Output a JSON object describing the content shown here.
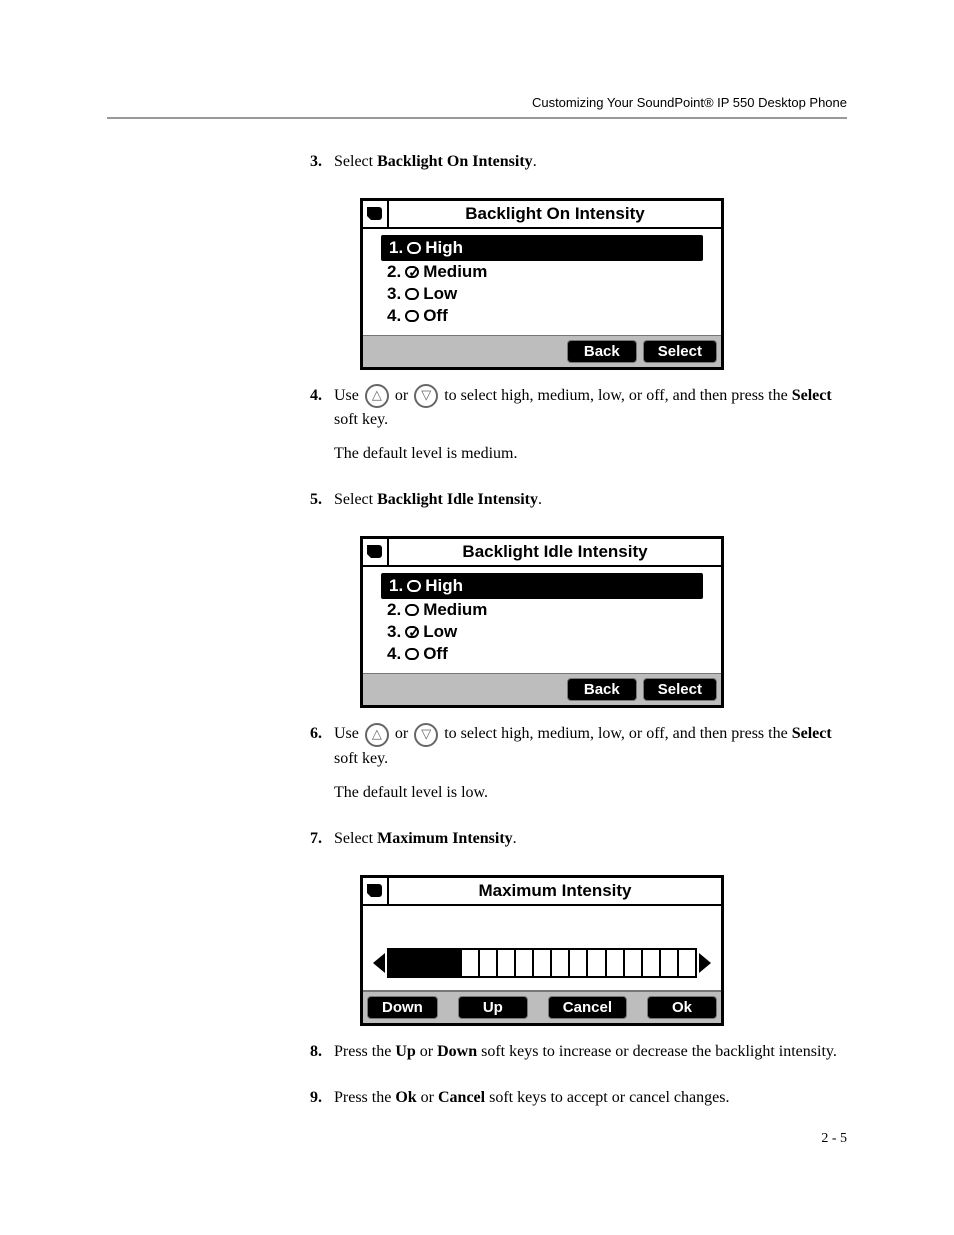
{
  "header": {
    "title": "Customizing Your SoundPoint® IP 550 Desktop Phone"
  },
  "footer": {
    "label": "2 - 5"
  },
  "steps": {
    "s3": {
      "num": "3.",
      "text_a": "Select ",
      "text_b": "Backlight On Intensity",
      "text_c": "."
    },
    "s4": {
      "num": "4.",
      "text_a": "Use ",
      "text_b": " or ",
      "text_c": " to select high, medium, low, or off, and then press the ",
      "text_d": "Select",
      "text_e": " soft key.",
      "default_line": "The default level is medium."
    },
    "s5": {
      "num": "5.",
      "text_a": "Select ",
      "text_b": "Backlight Idle Intensity",
      "text_c": "."
    },
    "s6": {
      "num": "6.",
      "text_a": "Use ",
      "text_b": " or ",
      "text_c": " to select high, medium, low, or off, and then press the ",
      "text_d": "Select",
      "text_e": " soft key.",
      "default_line": "The default level is low."
    },
    "s7": {
      "num": "7.",
      "text_a": "Select ",
      "text_b": "Maximum Intensity",
      "text_c": "."
    },
    "s8": {
      "num": "8.",
      "text_a": "Press the ",
      "text_b": "Up",
      "text_c": " or ",
      "text_d": "Down",
      "text_e": " soft keys to increase or decrease the backlight intensity."
    },
    "s9": {
      "num": "9.",
      "text_a": "Press the ",
      "text_b": "Ok",
      "text_c": " or ",
      "text_d": "Cancel",
      "text_e": " soft keys to accept or cancel changes."
    }
  },
  "screen_on": {
    "title": "Backlight On Intensity",
    "items": [
      {
        "num": "1.",
        "label": "High",
        "checked": false,
        "selected": true
      },
      {
        "num": "2.",
        "label": "Medium",
        "checked": true,
        "selected": false
      },
      {
        "num": "3.",
        "label": "Low",
        "checked": false,
        "selected": false
      },
      {
        "num": "4.",
        "label": "Off",
        "checked": false,
        "selected": false
      }
    ],
    "softkeys": {
      "back": "Back",
      "select": "Select"
    }
  },
  "screen_idle": {
    "title": "Backlight Idle Intensity",
    "items": [
      {
        "num": "1.",
        "label": "High",
        "checked": false,
        "selected": true
      },
      {
        "num": "2.",
        "label": "Medium",
        "checked": false,
        "selected": false
      },
      {
        "num": "3.",
        "label": "Low",
        "checked": true,
        "selected": false
      },
      {
        "num": "4.",
        "label": "Off",
        "checked": false,
        "selected": false
      }
    ],
    "softkeys": {
      "back": "Back",
      "select": "Select"
    }
  },
  "screen_max": {
    "title": "Maximum Intensity",
    "gauge_filled": 4,
    "gauge_total": 17,
    "softkeys": {
      "down": "Down",
      "up": "Up",
      "cancel": "Cancel",
      "ok": "Ok"
    }
  }
}
